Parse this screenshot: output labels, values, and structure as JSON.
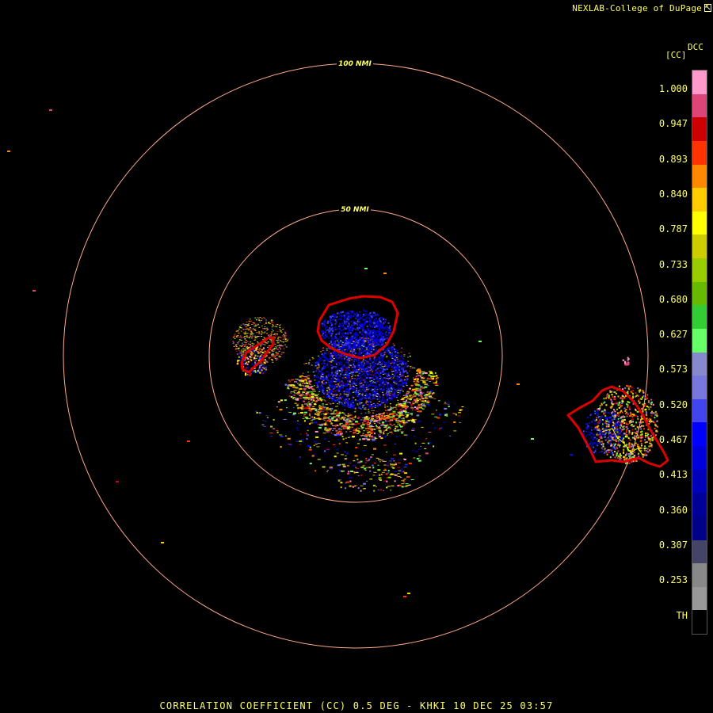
{
  "header": {
    "credit": "NEXLAB-College of DuPage",
    "credit_icon": "cursor-arrow-icon"
  },
  "legend": {
    "product_code": "DCC",
    "unit": "[CC]",
    "labels": [
      "1.000",
      "0.947",
      "0.893",
      "0.840",
      "0.787",
      "0.733",
      "0.680",
      "0.627",
      "0.573",
      "0.520",
      "0.467",
      "0.413",
      "0.360",
      "0.307",
      "0.253",
      "TH"
    ],
    "colors": [
      {
        "value": 1.0,
        "color": "#ff99cc"
      },
      {
        "value": 0.98,
        "color": "#dd4477"
      },
      {
        "value": 0.96,
        "color": "#cc0000"
      },
      {
        "value": 0.947,
        "color": "#ff3300"
      },
      {
        "value": 0.93,
        "color": "#ff8800"
      },
      {
        "value": 0.91,
        "color": "#ffcc00"
      },
      {
        "value": 0.893,
        "color": "#ffff00"
      },
      {
        "value": 0.87,
        "color": "#cccc00"
      },
      {
        "value": 0.85,
        "color": "#99cc00"
      },
      {
        "value": 0.83,
        "color": "#66bb00"
      },
      {
        "value": 0.8,
        "color": "#33cc33"
      },
      {
        "value": 0.787,
        "color": "#66ff66"
      },
      {
        "value": 0.76,
        "color": "#8888cc"
      },
      {
        "value": 0.733,
        "color": "#7777dd"
      },
      {
        "value": 0.72,
        "color": "#4444ee"
      },
      {
        "value": 0.7,
        "color": "#0000ff"
      },
      {
        "value": 0.65,
        "color": "#0000dd"
      },
      {
        "value": 0.6,
        "color": "#0000bb"
      },
      {
        "value": 0.55,
        "color": "#000099"
      },
      {
        "value": 0.47,
        "color": "#000088"
      },
      {
        "value": 0.43,
        "color": "#444466"
      },
      {
        "value": 0.413,
        "color": "#888888"
      },
      {
        "value": 0.2,
        "color": "#999999"
      },
      {
        "value": 0.18,
        "color": "#000000"
      }
    ]
  },
  "rings": [
    {
      "label": "50 NMI",
      "range_nmi": 50
    },
    {
      "label": "100 NMI",
      "range_nmi": 100
    }
  ],
  "radar": {
    "station": "KHKI",
    "product": "CORRELATION COEFFICIENT (CC)",
    "tilt": "0.5 DEG",
    "date": "10 DEC 25",
    "time": "03:57",
    "ring_color": "#ffaa88",
    "outline_color": "#dd0000"
  },
  "footer": {
    "text": "CORRELATION COEFFICIENT (CC) 0.5 DEG - KHKI 10 DEC 25 03:57"
  }
}
